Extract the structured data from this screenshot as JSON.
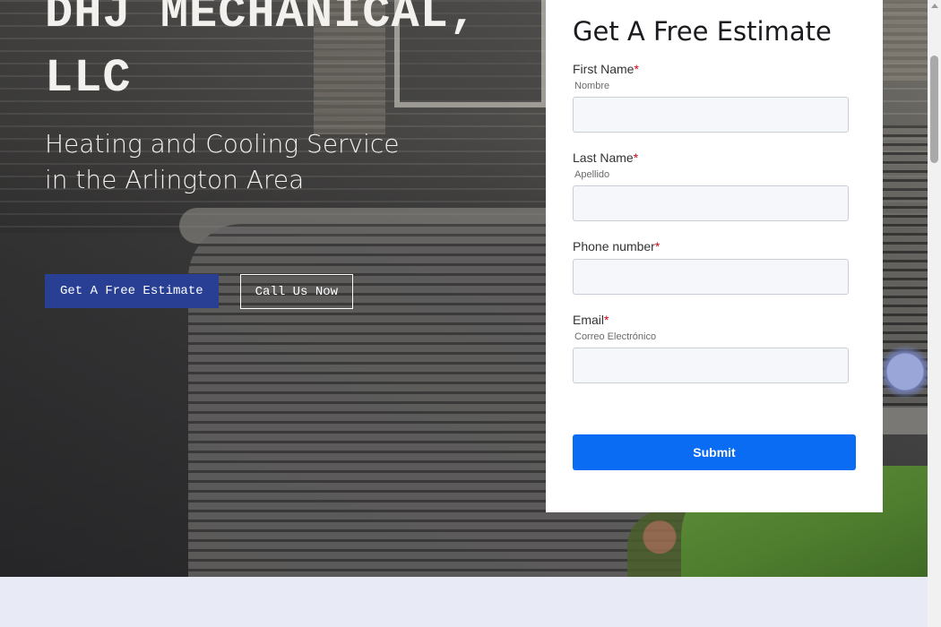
{
  "hero": {
    "brand": "DHJ MECHANICAL, LLC",
    "tagline": "Heating and Cooling Service in the Arlington Area",
    "primary_button": "Get A Free Estimate",
    "secondary_button": "Call Us Now"
  },
  "form": {
    "title": "Get A Free Estimate",
    "required_marker": "*",
    "fields": [
      {
        "label": "First Name",
        "sublabel": "Nombre"
      },
      {
        "label": "Last Name",
        "sublabel": "Apellido"
      },
      {
        "label": "Phone number",
        "sublabel": ""
      },
      {
        "label": "Email",
        "sublabel": "Correo Electrónico"
      }
    ],
    "submit_label": "Submit"
  },
  "colors": {
    "primary_button": "#283f94",
    "submit_button": "#0a6cf3",
    "required": "#d0021b",
    "section_bg": "#e8eaf6"
  }
}
